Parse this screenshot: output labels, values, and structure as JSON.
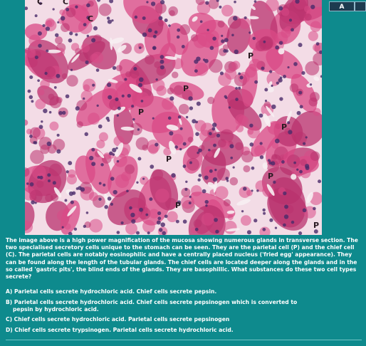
{
  "micrograph": {
    "labels": {
      "c1": "C",
      "c2": "C",
      "c3": "C",
      "p1": "P",
      "p2": "P",
      "p3": "P",
      "p4": "P",
      "p5": "P",
      "p6": "P",
      "p7": "P",
      "p8": "P"
    },
    "colors": {
      "background": "#f3dce6",
      "cytoplasm": "#d94a86",
      "deep_cytoplasm": "#b9316d",
      "nucleus": "#4a2a6a",
      "lumen": "#f7eef2"
    }
  },
  "nav": {
    "btn_a": "A",
    "btn_b": ""
  },
  "question": {
    "description": "The image above is a high power magnification of the mucosa showing numerous glands in transverse section. The two specialised secretory cells unique to the stomach can be seen. They are the parietal cell (P) and the chief cell (C). The parietal cells are notably eosinophilic and have a centrally placed nucleus ('fried egg' appearance). They can be found along the length of the tubular glands. The chief cells are located deeper along the glands and in the so called 'gastric pits', the blind ends of the glands. They are basophillic. What substances do these two cell types secrete?",
    "options": [
      {
        "line1": "A) Parietal cells secrete hydrochloric acid. Chief cells secrete pepsin.",
        "line2": ""
      },
      {
        "line1": "B) Parietal cells secrete hydrochloric acid. Chief cells secrete pepsinogen which is converted to",
        "line2": "pepsin by hydrochloric acid."
      },
      {
        "line1": "C) Chief cells secrete hydrochloric acid. Parietal cells secrete pepsinogen",
        "line2": ""
      },
      {
        "line1": "D) Chief cells secrete trypsinogen. Parietal cells secrete hydrochloric acid.",
        "line2": ""
      }
    ]
  },
  "theme": {
    "page_bg": "#0e8a8d",
    "text": "#ffffff",
    "nav_bg": "#1d3b4f"
  }
}
